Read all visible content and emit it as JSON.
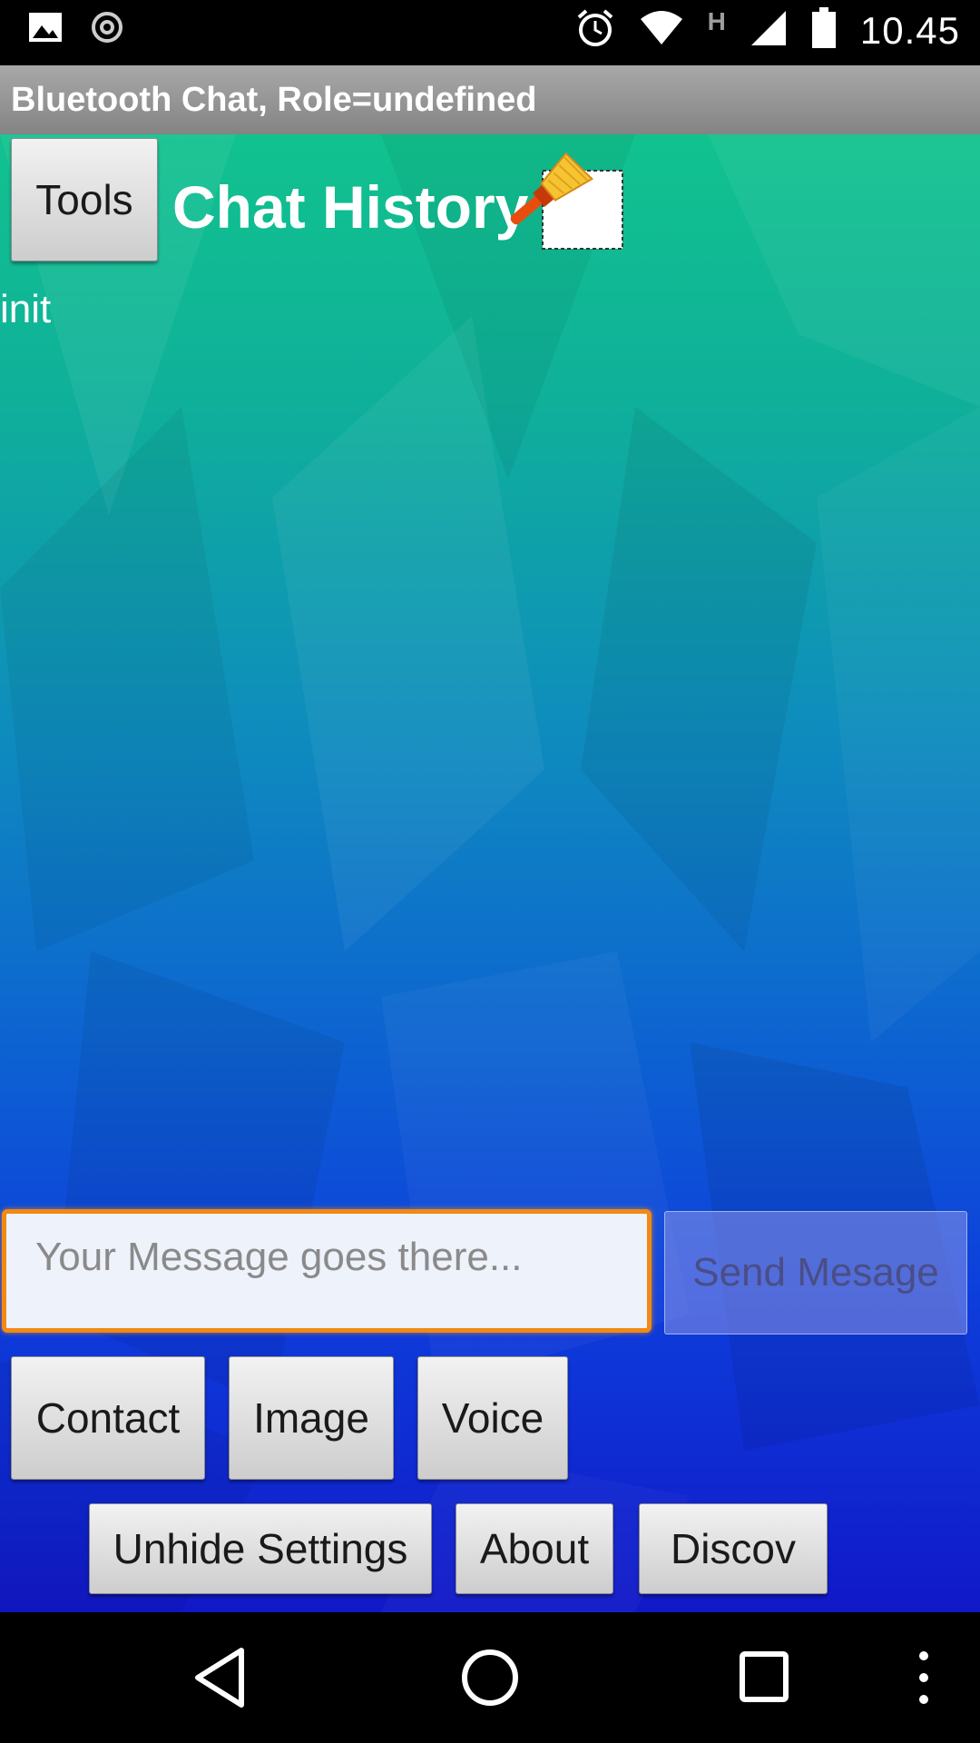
{
  "status_bar": {
    "time": "10.45",
    "network_type": "H",
    "icons": [
      "image-icon",
      "sync-icon",
      "alarm-icon",
      "wifi-icon",
      "signal-icon",
      "battery-icon"
    ]
  },
  "app": {
    "title": "Bluetooth Chat, Role=undefined"
  },
  "header": {
    "tools_label": "Tools",
    "chat_history_label": "Chat History",
    "clear_icon": "broom-icon"
  },
  "chat": {
    "lines": [
      "init"
    ]
  },
  "composer": {
    "placeholder": "Your Message goes there...",
    "value": "",
    "send_label": "Send Mesage"
  },
  "actions_row1": {
    "contact_label": "Contact",
    "image_label": "Image",
    "voice_label": "Voice"
  },
  "actions_row2": {
    "unhide_label": "Unhide Settings",
    "about_label": "About",
    "discov_label": "Discov"
  },
  "nav_bar": {
    "icons": [
      "back-icon",
      "home-icon",
      "recents-icon",
      "overflow-menu-icon"
    ]
  },
  "colors": {
    "accent_focus": "#f08a14",
    "title_bar": "#939393",
    "wallpaper_top": "#11c28e",
    "wallpaper_bottom": "#1118c8"
  }
}
